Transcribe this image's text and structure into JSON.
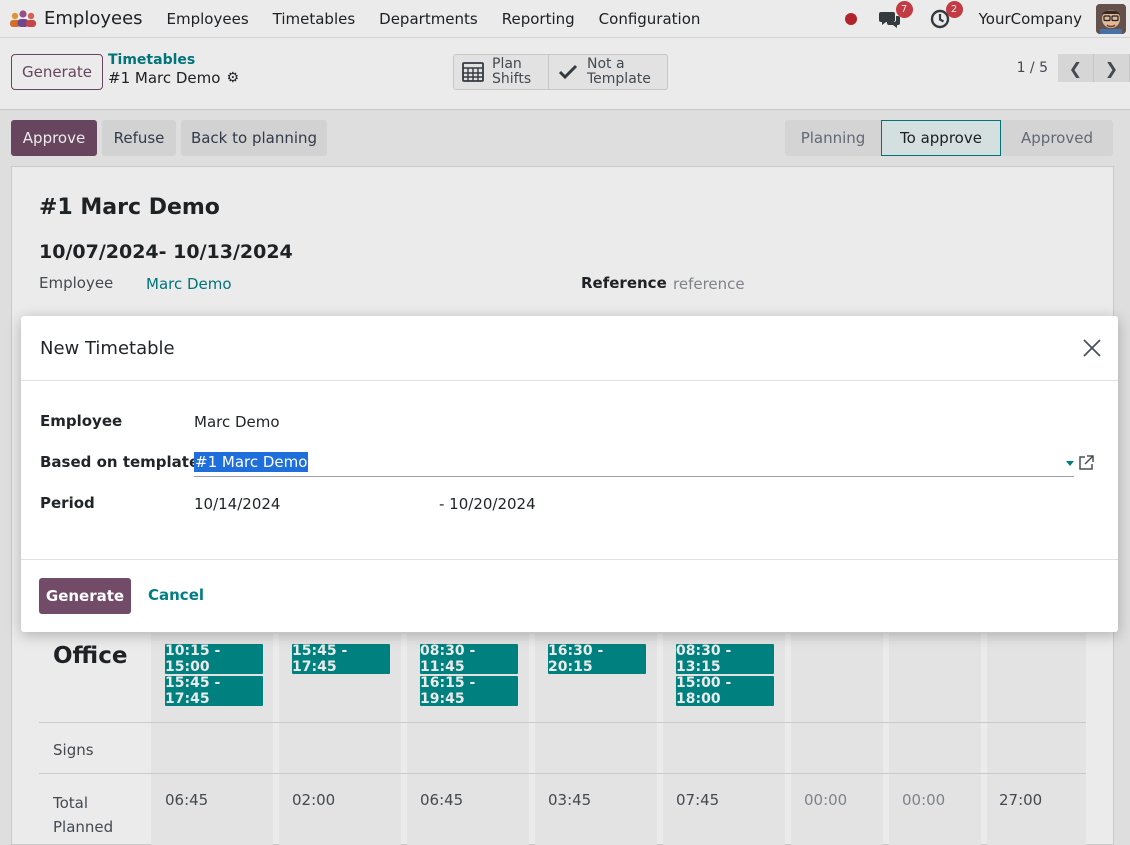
{
  "navbar": {
    "app_title": "Employees",
    "menu": [
      "Employees",
      "Timetables",
      "Departments",
      "Reporting",
      "Configuration"
    ],
    "messages_count": "7",
    "activities_count": "2",
    "company": "YourCompany"
  },
  "control": {
    "generate_label": "Generate",
    "breadcrumb_parent": "Timetables",
    "breadcrumb_current": "#1 Marc Demo",
    "plan_shifts_label": "Plan Shifts",
    "not_template_label": "Not a Template",
    "pager_text": "1 / 5"
  },
  "status": {
    "approve_label": "Approve",
    "refuse_label": "Refuse",
    "back_label": "Back to planning",
    "stages": [
      "Planning",
      "To approve",
      "Approved"
    ],
    "active_stage": "To approve"
  },
  "record": {
    "title": "#1 Marc Demo",
    "dates": "10/07/2024- 10/13/2024",
    "employee_label": "Employee",
    "employee_value": "Marc Demo",
    "reference_label": "Reference",
    "reference_placeholder": "reference"
  },
  "grid": {
    "office_label": "Office",
    "shifts": [
      [
        "10:15 - 15:00",
        "15:45 - 17:45"
      ],
      [
        "15:45 - 17:45"
      ],
      [
        "08:30 - 11:45",
        "16:15 - 19:45"
      ],
      [
        "16:30 - 20:15"
      ],
      [
        "08:30 - 13:15",
        "15:00 - 18:00"
      ],
      [],
      [],
      []
    ],
    "signs_label": "Signs",
    "total_label": "Total Planned",
    "totals": [
      "06:45",
      "02:00",
      "06:45",
      "03:45",
      "07:45",
      "00:00",
      "00:00",
      "27:00"
    ]
  },
  "dialog": {
    "title": "New Timetable",
    "employee_label": "Employee",
    "employee_value": "Marc Demo",
    "template_label": "Based on template",
    "template_value": "#1 Marc Demo",
    "period_label": "Period",
    "period_start": "10/14/2024",
    "period_end": "- 10/20/2024",
    "generate_label": "Generate",
    "cancel_label": "Cancel"
  },
  "colors": {
    "brand": "#714b67",
    "accent": "#017e84",
    "shift": "#018d8b"
  }
}
